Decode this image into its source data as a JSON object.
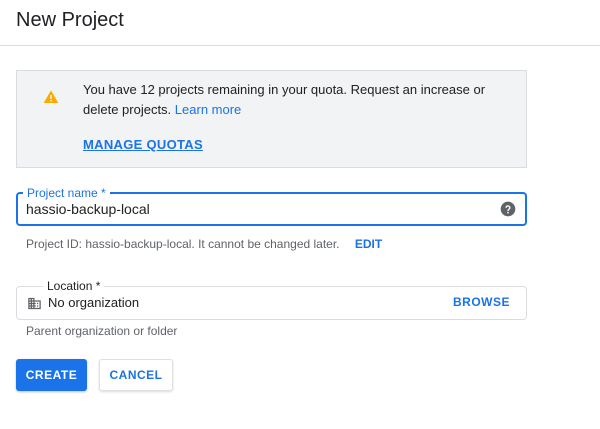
{
  "header": {
    "title": "New Project"
  },
  "notice": {
    "text": "You have 12 projects remaining in your quota. Request an increase or delete projects.",
    "learn_more": "Learn more",
    "manage_quotas": "MANAGE QUOTAS",
    "icon": "warning-icon",
    "icon_color": "#f9ab00"
  },
  "project_name": {
    "label": "Project name *",
    "value": "hassio-backup-local",
    "help_icon": "help-icon"
  },
  "project_id": {
    "text": "Project ID: hassio-backup-local. It cannot be changed later.",
    "edit": "EDIT"
  },
  "location": {
    "label": "Location *",
    "value": "No organization",
    "browse": "BROWSE",
    "hint": "Parent organization or folder",
    "icon": "building-icon"
  },
  "buttons": {
    "create": "CREATE",
    "cancel": "CANCEL"
  },
  "colors": {
    "accent": "#1a73e8",
    "notice_bg": "#f1f3f4"
  }
}
